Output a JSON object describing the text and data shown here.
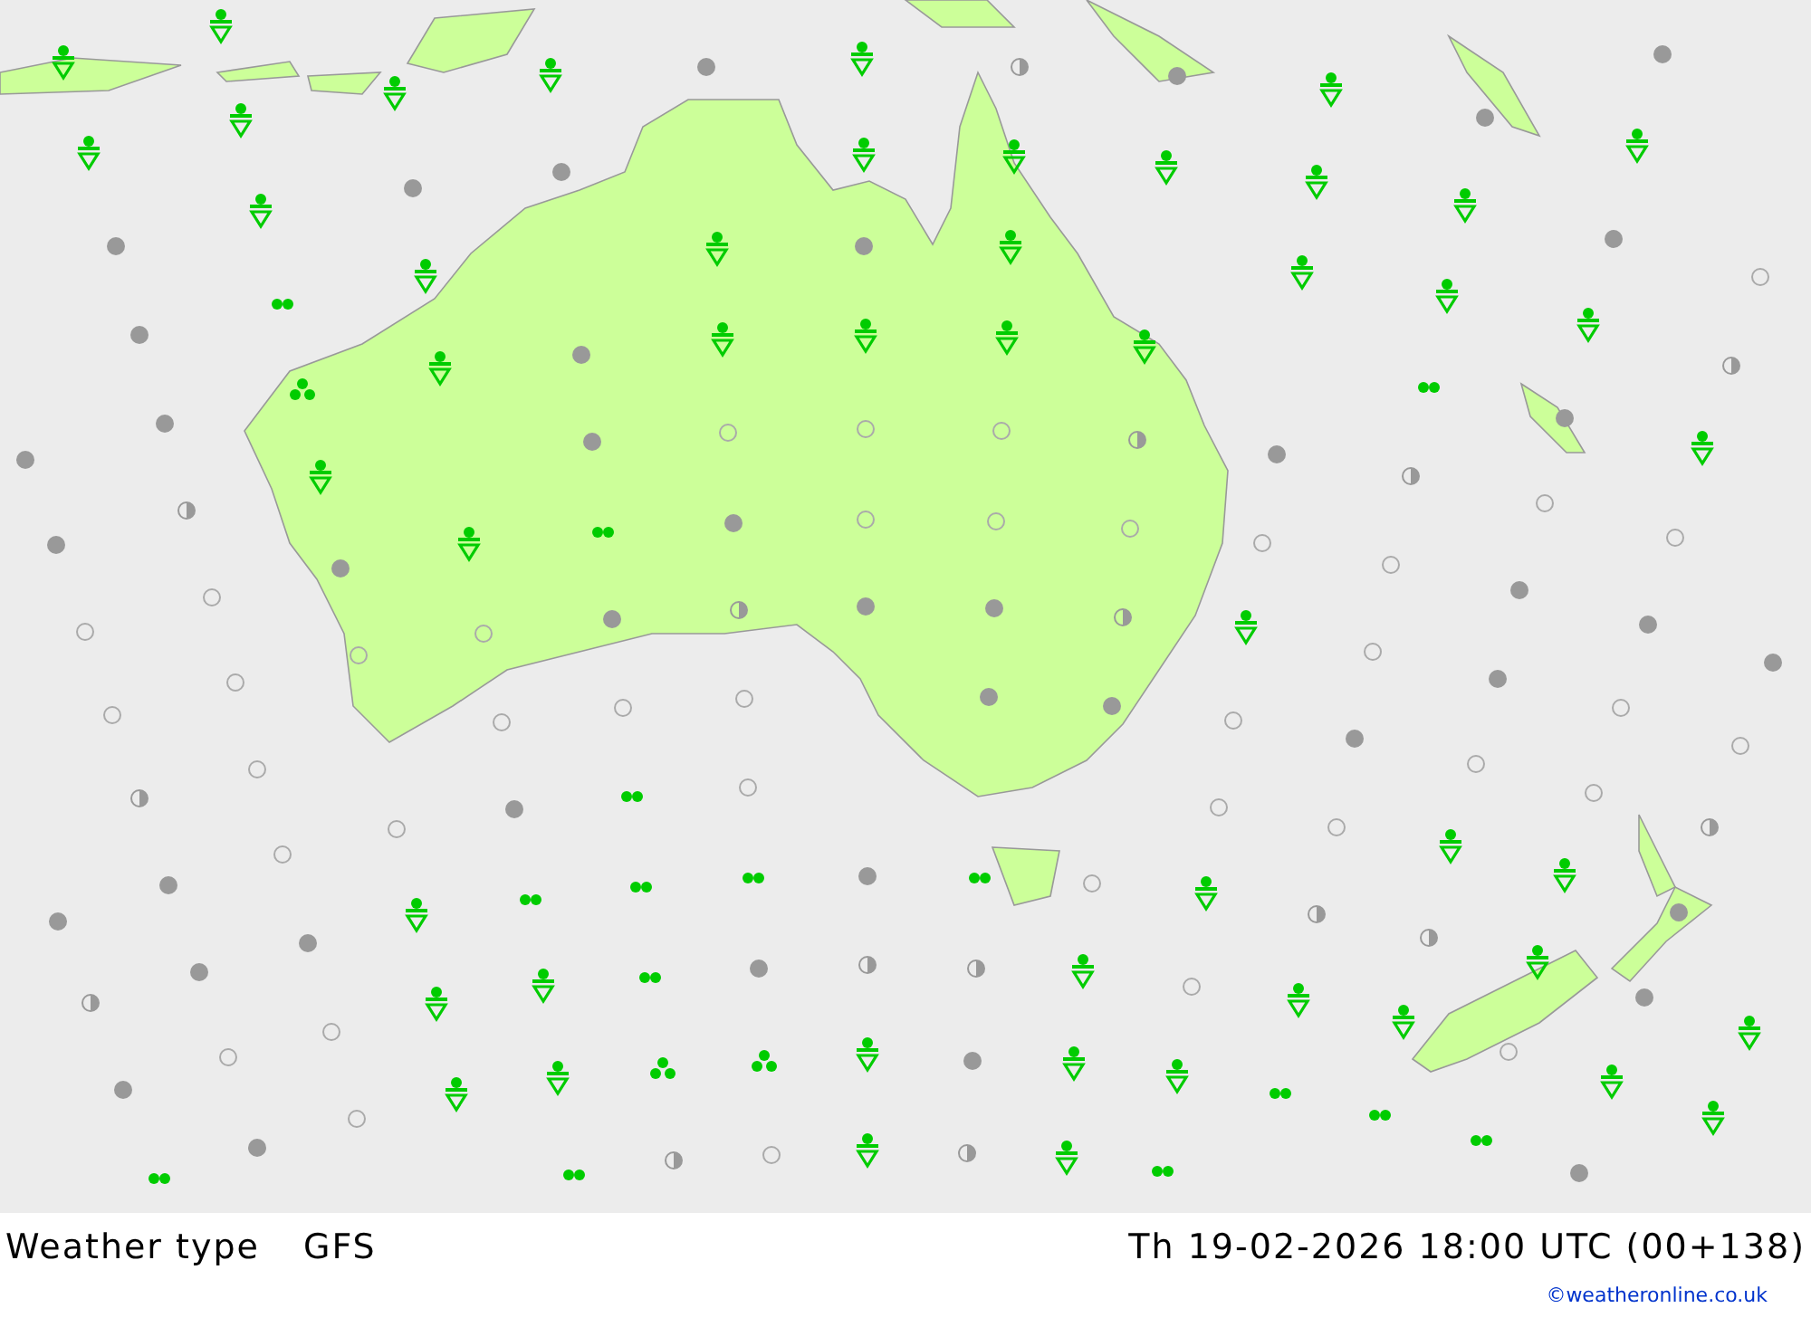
{
  "legend": {
    "title": "Weather type",
    "model": "GFS"
  },
  "valid_time": "Th 19-02-2026 18:00 UTC (00+138)",
  "credit": "©weatheronline.co.uk"
}
